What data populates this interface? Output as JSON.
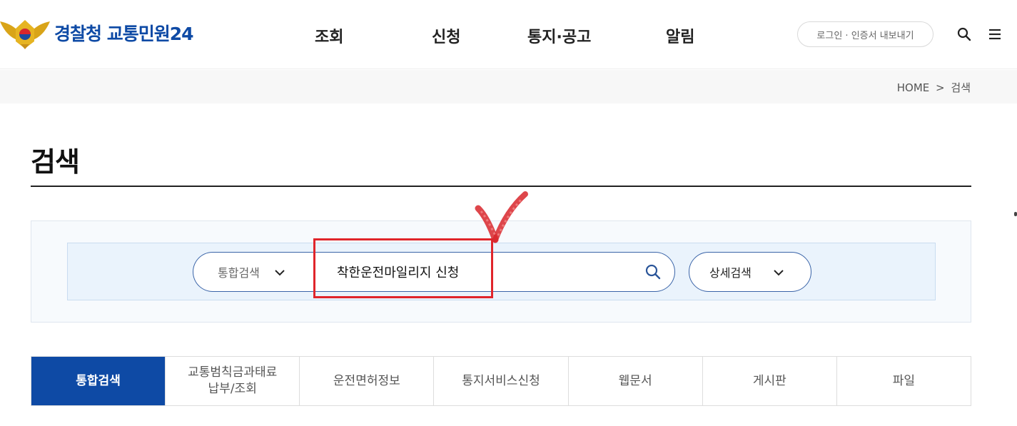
{
  "header": {
    "logo_icon": "police-emblem-icon",
    "logo_text": "경찰청 교통민원24",
    "nav": [
      {
        "label": "조회"
      },
      {
        "label": "신청"
      },
      {
        "label": "통지·공고"
      },
      {
        "label": "알림"
      }
    ],
    "login_label": "로그인 · 인증서 내보내기",
    "search_icon": "search-icon",
    "menu_icon": "hamburger-menu-icon"
  },
  "breadcrumb": {
    "home": "HOME",
    "separator": ">",
    "current": "검색"
  },
  "page": {
    "title": "검색"
  },
  "search": {
    "scope_selected": "통합검색",
    "query": "착한운전마일리지 신청",
    "detail_label": "상세검색",
    "search_icon": "search-icon",
    "chevron_icon": "chevron-down-icon"
  },
  "tabs": [
    {
      "label": "통합검색",
      "active": true
    },
    {
      "label": "교통범칙금과태료\n납부/조회",
      "active": false
    },
    {
      "label": "운전면허정보",
      "active": false
    },
    {
      "label": "통지서비스신청",
      "active": false
    },
    {
      "label": "웹문서",
      "active": false
    },
    {
      "label": "게시판",
      "active": false
    },
    {
      "label": "파일",
      "active": false
    }
  ],
  "colors": {
    "brand": "#0e4aa5",
    "annotation": "#e0252b",
    "panel_bg": "#eaf3fc",
    "input_border": "#3a64a8"
  }
}
